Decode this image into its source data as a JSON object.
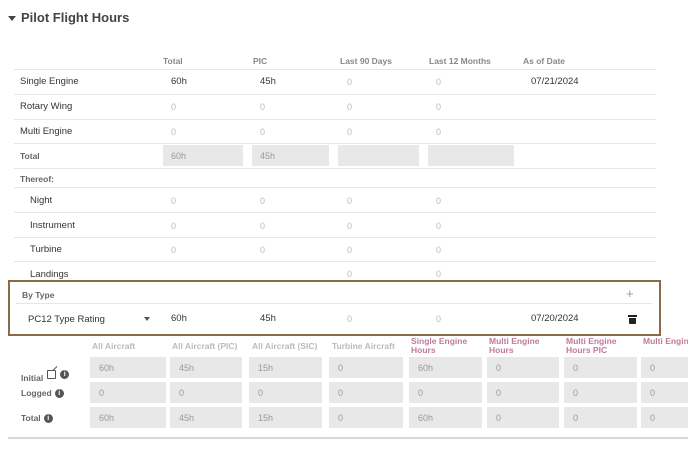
{
  "section": {
    "title": "Pilot Flight Hours"
  },
  "columns": [
    "Total",
    "PIC",
    "Last 90 Days",
    "Last 12 Months",
    "As of Date"
  ],
  "rows": {
    "single_engine": {
      "label": "Single Engine",
      "total": "60h",
      "pic": "45h",
      "last90": "0",
      "last12": "0",
      "asof": "07/21/2024"
    },
    "rotary_wing": {
      "label": "Rotary Wing",
      "total": "0",
      "pic": "0",
      "last90": "0",
      "last12": "0"
    },
    "multi_engine": {
      "label": "Multi Engine",
      "total": "0",
      "pic": "0",
      "last90": "0",
      "last12": "0"
    },
    "total": {
      "label": "Total",
      "total": "60h",
      "pic": "45h"
    },
    "thereof": {
      "label": "Thereof:"
    },
    "night": {
      "label": "Night",
      "total": "0",
      "pic": "0",
      "last90": "0",
      "last12": "0"
    },
    "instrument": {
      "label": "Instrument",
      "total": "0",
      "pic": "0",
      "last90": "0",
      "last12": "0"
    },
    "turbine": {
      "label": "Turbine",
      "total": "0",
      "pic": "0",
      "last90": "0",
      "last12": "0"
    },
    "landings": {
      "label": "Landings",
      "last90": "0",
      "last12": "0"
    }
  },
  "by_type": {
    "label": "By Type",
    "add_icon": "+",
    "rating": {
      "name": "PC12 Type Rating",
      "total": "60h",
      "pic": "45h",
      "last90": "0",
      "last12": "0",
      "asof": "07/20/2024"
    }
  },
  "detail": {
    "headers": [
      "All Aircraft",
      "All Aircraft (PIC)",
      "All Aircraft (SIC)",
      "Turbine Aircraft",
      "Single Engine Hours",
      "Multi Engine Hours",
      "Multi Engine Hours PIC",
      "Multi Engine Hours SIC"
    ],
    "rows": [
      {
        "label": "Initial",
        "values": [
          "60h",
          "45h",
          "15h",
          "0",
          "60h",
          "0",
          "0",
          "0"
        ]
      },
      {
        "label": "Logged",
        "values": [
          "0",
          "0",
          "0",
          "0",
          "0",
          "0",
          "0",
          "0"
        ]
      },
      {
        "label": "Total",
        "values": [
          "60h",
          "45h",
          "15h",
          "0",
          "60h",
          "0",
          "0",
          "0"
        ]
      }
    ]
  },
  "info_icon": "i"
}
